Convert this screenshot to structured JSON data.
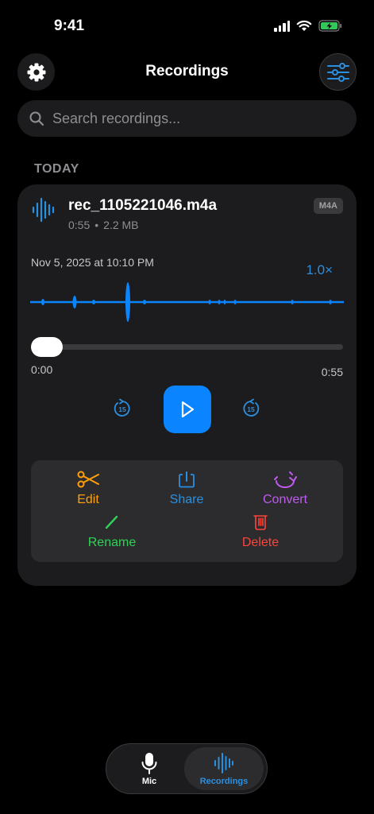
{
  "status_bar": {
    "time": "9:41",
    "icons": [
      "signal-icon",
      "wifi-icon",
      "battery-charging-icon"
    ]
  },
  "header": {
    "title": "Recordings",
    "left_icon": "gear-icon",
    "right_icon": "sliders-icon"
  },
  "search": {
    "placeholder": "Search recordings...",
    "icon": "search-icon"
  },
  "section": {
    "label": "TODAY"
  },
  "recording": {
    "file_name": "rec_1105221046.m4a",
    "duration": "0:55",
    "separator": "•",
    "size": "2.2 MB",
    "format": "M4A",
    "date": "Nov 5, 2025 at 10:10 PM",
    "speed": "1.0×",
    "progress": 0,
    "time_current": "0:00",
    "time_total": "0:55",
    "skip_seconds": "15"
  },
  "actions": [
    {
      "label": "Edit",
      "icon": "scissors-icon",
      "color": "#ff9f0a"
    },
    {
      "label": "Share",
      "icon": "share-icon",
      "color": "#2b8fe0"
    },
    {
      "label": "Convert",
      "icon": "convert-icon",
      "color": "#bf5af2"
    },
    {
      "label": "Rename",
      "icon": "pencil-icon",
      "color": "#30d158"
    },
    {
      "label": "Delete",
      "icon": "trash-icon",
      "color": "#ff453a"
    }
  ],
  "tab_bar": {
    "tabs": [
      {
        "label": "Mic",
        "icon": "microphone-icon",
        "active": false
      },
      {
        "label": "Recordings",
        "icon": "waveform-icon",
        "active": true
      }
    ]
  },
  "colors": {
    "accent": "#0a84ff",
    "background": "#000000",
    "card": "#1c1c1e"
  }
}
